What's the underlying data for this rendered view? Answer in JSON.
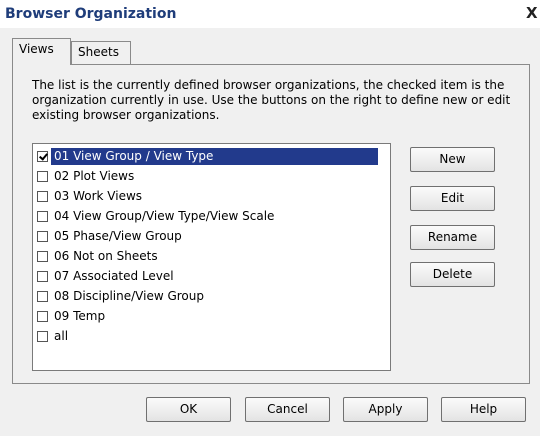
{
  "window": {
    "title": "Browser Organization",
    "close_glyph": "X"
  },
  "tabs": [
    {
      "label": "Views"
    },
    {
      "label": "Sheets"
    }
  ],
  "description": "The list is the currently defined browser organizations,  the checked item is the organization currently in use. Use the buttons on the right to define new or edit existing browser organizations.",
  "organizations": [
    {
      "label": "01 View Group / View Type",
      "checked": true,
      "selected": true
    },
    {
      "label": "02 Plot Views",
      "checked": false
    },
    {
      "label": "03 Work Views",
      "checked": false
    },
    {
      "label": "04 View Group/View Type/View Scale",
      "checked": false
    },
    {
      "label": "05 Phase/View Group",
      "checked": false
    },
    {
      "label": "06 Not on Sheets",
      "checked": false
    },
    {
      "label": "07 Associated Level",
      "checked": false
    },
    {
      "label": "08 Discipline/View Group",
      "checked": false
    },
    {
      "label": "09 Temp",
      "checked": false
    },
    {
      "label": "all",
      "checked": false
    }
  ],
  "side_buttons": {
    "new": "New",
    "edit": "Edit",
    "rename": "Rename",
    "delete": "Delete"
  },
  "dialog_buttons": {
    "ok": "OK",
    "cancel": "Cancel",
    "apply": "Apply",
    "help": "Help"
  }
}
